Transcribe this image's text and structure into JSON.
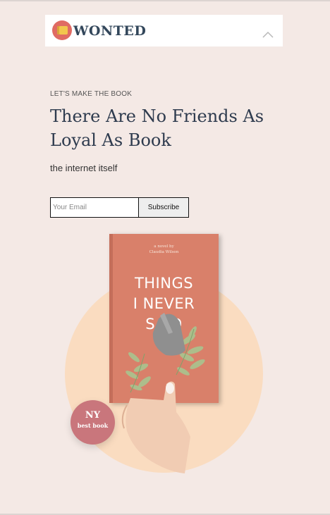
{
  "header": {
    "brand": "WONTED",
    "menu_icon": "chevron-up-icon"
  },
  "hero": {
    "eyebrow": "LET'S MAKE THE BOOK",
    "title_line1": "There Are No Friends As",
    "title_line2": "Loyal As Book",
    "subtitle": "the internet itself"
  },
  "subscribe_form": {
    "email_placeholder": "Your Email",
    "email_value": "",
    "button_label": "Subscribe"
  },
  "book": {
    "byline": "a novel by",
    "author": "Claudia Wilson",
    "title_line1": "THINGS",
    "title_line2": "I NEVER",
    "title_line3": "SAID"
  },
  "badge": {
    "big": "NY",
    "small": "best book"
  },
  "colors": {
    "page_bg": "#f4e9e5",
    "title": "#2e3b4e",
    "book_cover": "#d9806a",
    "circle": "#fadcc0",
    "badge": "#c9767c",
    "logo_accent": "#e06b63"
  }
}
